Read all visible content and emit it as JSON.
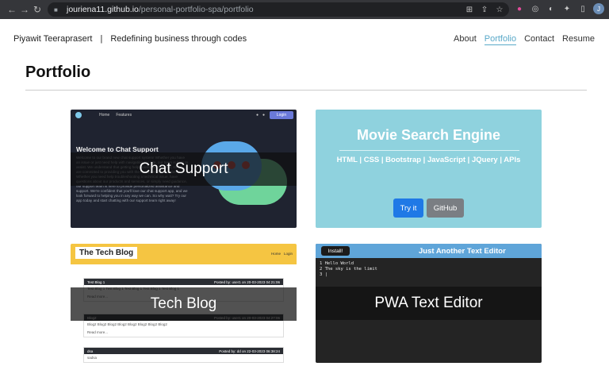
{
  "browser": {
    "url_host": "jouriena11.github.io",
    "url_path": "/personal-portfolio-spa/portfolio",
    "avatar_letter": "J"
  },
  "header": {
    "name": "Piyawit Teeraprasert",
    "separator": "|",
    "tagline": "Redefining business through codes",
    "nav": [
      "About",
      "Portfolio",
      "Contact",
      "Resume"
    ],
    "active_nav": "Portfolio",
    "accent_color": "#5aa9c9"
  },
  "page": {
    "title": "Portfolio"
  },
  "projects": [
    {
      "title": "Chat Support",
      "preview": {
        "nav_links": [
          "Home",
          "Features"
        ],
        "login_label": "Login",
        "welcome": "Welcome to Chat Support",
        "body": "Welcome to our brand new chat support system! Whether you have an issue or just need help with navigating our site, our team is here to assist. We understand that getting help quickly is important, so we are committed to providing you with the best possible experience. Whether you need help troubleshooting a technical issue, have questions about our products and services, or simply need guidance, our support team is here to provide personalized assistance and support. We're confident that you'll love our chat support app, and we look forward to helping you in any way we can. So why wait? Try our app today and start chatting with our support team right away!"
      }
    },
    {
      "title": "Movie Search Engine",
      "tech": "HTML | CSS | Bootstrap | JavaScript | JQuery | APIs",
      "buttons": [
        "Try it",
        "GitHub"
      ]
    },
    {
      "title": "Tech Blog",
      "preview": {
        "brand": "The Tech Blog",
        "links": [
          "Home",
          "Login"
        ],
        "posts": [
          {
            "title": "Test Blog 1",
            "meta": "Posted by: user1 on 20-03-2023 04:21:06",
            "body": "Test Blog 1 Test Blog 1 Test Blog 1 Test Blog 1 Test Blog 1",
            "more": "Read more..."
          },
          {
            "title": "Blog2",
            "meta": "Posted by: user1 on 20-03-2023 04:27:06",
            "body": "Blog2 Blog2 Blog2 Blog2 Blog2 Blog2 Blog2 Blog2",
            "more": "Read more..."
          },
          {
            "title": "dsa",
            "meta": "Posted by: dd on 22-03-2023 06:38:24",
            "body": "sadsa",
            "more": ""
          }
        ]
      }
    },
    {
      "title": "PWA Text Editor",
      "preview": {
        "install_label": "Install!",
        "header": "Just Another Text Editor",
        "lines": [
          "1 Hello World",
          "2 The sky is the limit",
          "3 |"
        ]
      }
    }
  ]
}
